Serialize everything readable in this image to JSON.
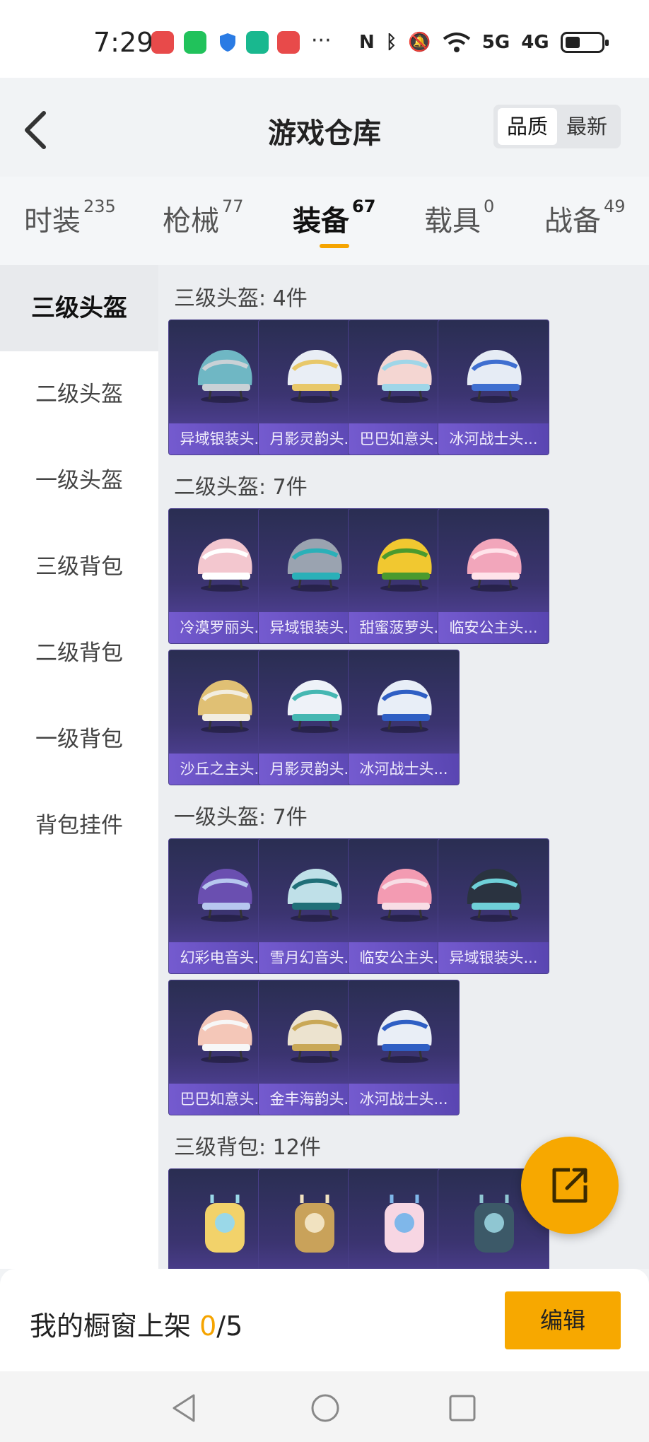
{
  "status_bar": {
    "time": "7:29",
    "icons": [
      "huawei-appgallery-icon",
      "wechat-icon",
      "shield-icon",
      "security-check-icon",
      "huawei-store-icon",
      "nfc-icon",
      "bluetooth-icon",
      "mute-icon",
      "wifi-icon",
      "5g-signal-icon",
      "4g-signal-icon",
      "battery-icon"
    ],
    "signal_5g": "5G",
    "signal_4g": "4G",
    "more": "···",
    "battery_level": 0.4
  },
  "header": {
    "title": "游戏仓库",
    "sort_options": [
      "品质",
      "最新"
    ],
    "selected_sort": "品质"
  },
  "tabs": [
    {
      "label": "时装",
      "count": "235"
    },
    {
      "label": "枪械",
      "count": "77"
    },
    {
      "label": "装备",
      "count": "67"
    },
    {
      "label": "载具",
      "count": "0"
    },
    {
      "label": "战备",
      "count": "49"
    }
  ],
  "active_tab": "装备",
  "sidebar": {
    "items": [
      "三级头盔",
      "二级头盔",
      "一级头盔",
      "三级背包",
      "二级背包",
      "一级背包",
      "背包挂件"
    ],
    "active": "三级头盔"
  },
  "sections": [
    {
      "title": "三级头盔: 4件",
      "items": [
        {
          "name": "异域银装头...",
          "color": "#6fb7c4",
          "accent": "#c9d1d6"
        },
        {
          "name": "月影灵韵头...",
          "color": "#e9eef5",
          "accent": "#e8c86a"
        },
        {
          "name": "巴巴如意头...",
          "color": "#f4d6d2",
          "accent": "#9fd6e8"
        },
        {
          "name": "冰河战士头...",
          "color": "#e6ecf5",
          "accent": "#3f6fd0"
        }
      ]
    },
    {
      "title": "二级头盔: 7件",
      "items": [
        {
          "name": "冷漠罗丽头...",
          "color": "#f3c7cf",
          "accent": "#ffffff"
        },
        {
          "name": "异域银装头...",
          "color": "#9aa3b0",
          "accent": "#2ab0b8"
        },
        {
          "name": "甜蜜菠萝头...",
          "color": "#f1c830",
          "accent": "#4a9a2e"
        },
        {
          "name": "临安公主头...",
          "color": "#f2a6bb",
          "accent": "#ffe3ea"
        },
        {
          "name": "沙丘之主头...",
          "color": "#e0c074",
          "accent": "#f2ede0"
        },
        {
          "name": "月影灵韵头...",
          "color": "#eef2f8",
          "accent": "#45b7b2"
        },
        {
          "name": "冰河战士头...",
          "color": "#e8eef7",
          "accent": "#2f5fc4"
        }
      ]
    },
    {
      "title": "一级头盔: 7件",
      "items": [
        {
          "name": "幻彩电音头...",
          "color": "#6a4fb0",
          "accent": "#b7c7ef"
        },
        {
          "name": "雪月幻音头...",
          "color": "#bfe0e8",
          "accent": "#1f6f78"
        },
        {
          "name": "临安公主头...",
          "color": "#f39bb2",
          "accent": "#f8dde5"
        },
        {
          "name": "异域银装头...",
          "color": "#2a3340",
          "accent": "#6fd0d8"
        },
        {
          "name": "巴巴如意头...",
          "color": "#f4c7b8",
          "accent": "#f7f7f7"
        },
        {
          "name": "金丰海韵头...",
          "color": "#ece3cf",
          "accent": "#c9a857"
        },
        {
          "name": "冰河战士头...",
          "color": "#e9eef6",
          "accent": "#2f5fc4"
        }
      ]
    },
    {
      "title": "三级背包: 12件",
      "items": [
        {
          "name": "",
          "color": "#f2d26a",
          "accent": "#9ad8e8"
        },
        {
          "name": "",
          "color": "#c9a25a",
          "accent": "#f1e2c0"
        },
        {
          "name": "",
          "color": "#f7d6e3",
          "accent": "#7fb7ea"
        },
        {
          "name": "",
          "color": "#3c5968",
          "accent": "#8fc6d2"
        }
      ]
    }
  ],
  "bottom": {
    "label": "我的橱窗上架",
    "count": "0",
    "total": "/5",
    "edit_button": "编辑"
  },
  "fab_icon": "share-out-icon",
  "nav": [
    "back-nav-icon",
    "home-nav-icon",
    "recents-nav-icon"
  ],
  "colors": {
    "accent": "#f7a800",
    "card_gradient_bottom": "#5a47a8"
  }
}
